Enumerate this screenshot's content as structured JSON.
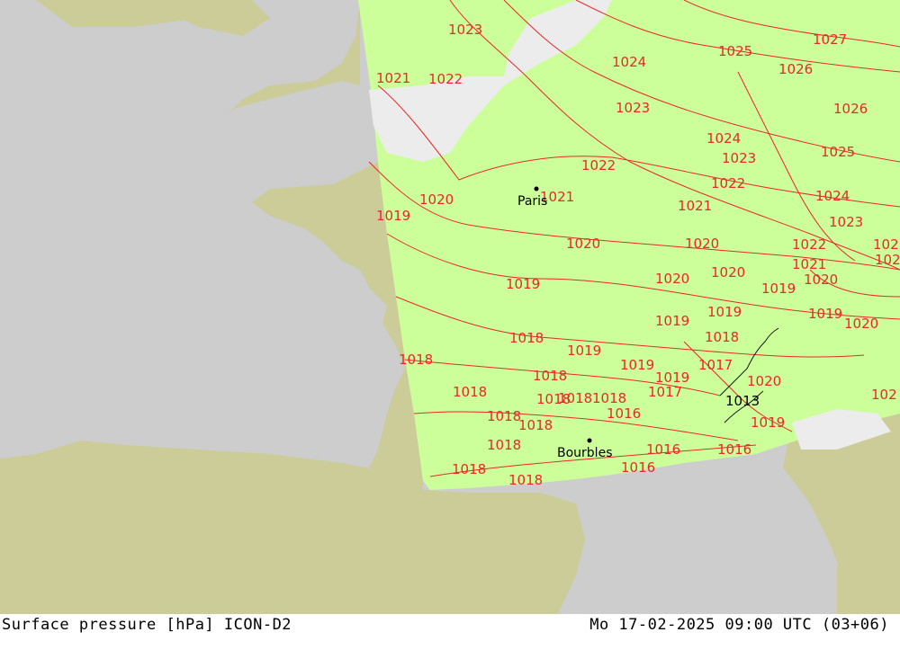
{
  "map": {
    "colors": {
      "sea": "#cdcdcd",
      "land": "#cccc99",
      "field": "#ccff99",
      "isobar": "#e8282a",
      "low_pressure_area": "#ececec"
    },
    "cities": [
      {
        "name": "Paris"
      },
      {
        "name": "Bourbles"
      }
    ],
    "isobar_labels": [
      "1023",
      "1024",
      "1025",
      "1027",
      "1026",
      "1026",
      "1021",
      "1022",
      "1023",
      "1024",
      "1023",
      "1025",
      "1022",
      "1022",
      "1024",
      "1020",
      "1021",
      "1019",
      "1021",
      "1023",
      "1020",
      "1020",
      "1022",
      "102",
      "1021",
      "102",
      "1019",
      "1020",
      "1020",
      "1020",
      "1019",
      "1019",
      "1019",
      "1020",
      "1019",
      "1019",
      "1018",
      "1018",
      "1018",
      "1019",
      "1017",
      "1018",
      "1019",
      "1018",
      "1018",
      "1018",
      "1017",
      "1018",
      "1018",
      "1013",
      "1020",
      "1018",
      "1016",
      "1018",
      "1016",
      "1016",
      "1018",
      "1018",
      "1016",
      "1019",
      "102"
    ]
  },
  "footer": {
    "left": "Surface pressure [hPa] ICON-D2",
    "right": "Mo 17-02-2025 09:00 UTC (03+06)"
  }
}
